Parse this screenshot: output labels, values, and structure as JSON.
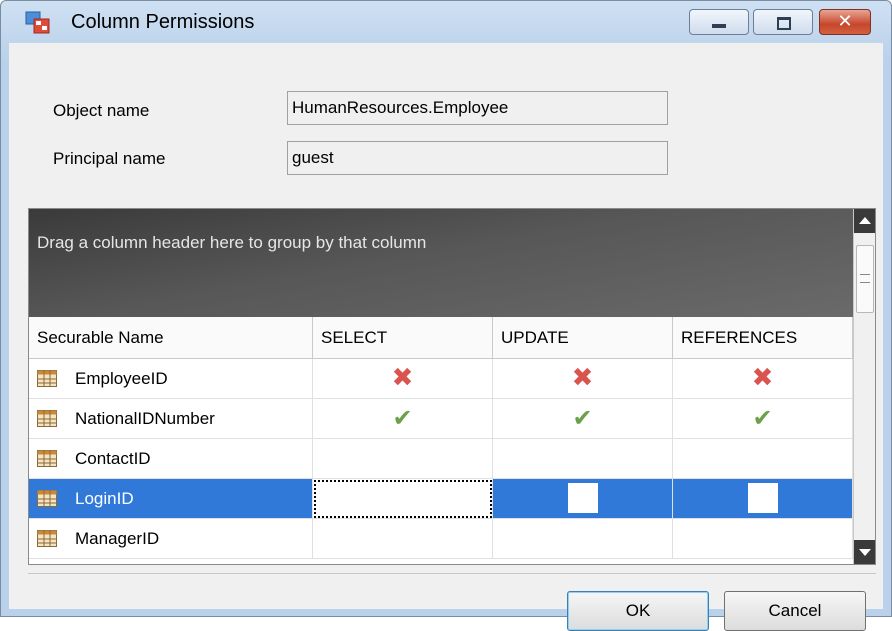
{
  "window": {
    "title": "Column Permissions",
    "controls": {
      "close_glyph": "✕"
    }
  },
  "form": {
    "object_label": "Object name",
    "object_value": "HumanResources.Employee",
    "principal_label": "Principal name",
    "principal_value": "guest"
  },
  "grid": {
    "group_panel_text": "Drag a column header here to group by that column",
    "columns": [
      "Securable Name",
      "SELECT",
      "UPDATE",
      "REFERENCES"
    ],
    "rows": [
      {
        "name": "EmployeeID",
        "select": "✖",
        "update": "✖",
        "references": "✖",
        "state": "deny"
      },
      {
        "name": "NationalIDNumber",
        "select": "✔",
        "update": "✔",
        "references": "✔",
        "state": "grant"
      },
      {
        "name": "ContactID",
        "select": "",
        "update": "",
        "references": "",
        "state": "none"
      },
      {
        "name": "LoginID",
        "select": "",
        "update": "",
        "references": "",
        "state": "selected"
      },
      {
        "name": "ManagerID",
        "select": "",
        "update": "",
        "references": "",
        "state": "none"
      }
    ],
    "icons": {
      "row_icon": "table-icon",
      "deny_icon": "deny-x-icon",
      "grant_icon": "grant-check-icon"
    },
    "colors": {
      "selection": "#3179d8",
      "deny": "#d9534f",
      "grant": "#6aa14a"
    }
  },
  "buttons": {
    "ok": "OK",
    "cancel": "Cancel"
  }
}
